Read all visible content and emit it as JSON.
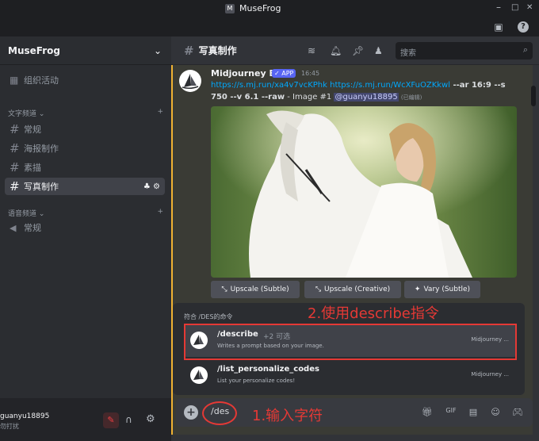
{
  "window": {
    "app_logo": "M",
    "title": "MuseFrog",
    "min": "–",
    "max": "□",
    "close": "✕"
  },
  "server": {
    "name": "MuseFrog",
    "events": "组织活动"
  },
  "categories": {
    "text": "文字频道",
    "voice": "语音频道"
  },
  "channels": {
    "c1": "常规",
    "c2": "海报制作",
    "c3": "素描",
    "c4": "写真制作",
    "v1": "常规"
  },
  "user": {
    "name": "guanyu18895",
    "status": "勿打扰"
  },
  "header": {
    "channel": "写真制作",
    "search_placeholder": "搜索"
  },
  "message": {
    "author": "Midjourney Bot",
    "badge": "✓ APP",
    "time": "16:45",
    "link1": "https://s.mj.run/xa4v7vcKPhk",
    "link2": "https://s.mj.run/WcXFuOZKkwl",
    "params1": " --ar 16:9 --s",
    "params2": "750 --v 6.1 --raw",
    "image_no": " - Image #1 ",
    "mention": "@guanyu18895",
    "edited": "(已编辑)"
  },
  "buttons": {
    "upscale_subtle": "Upscale (Subtle)",
    "upscale_creative": "Upscale (Creative)",
    "vary_subtle": "Vary (Subtle)"
  },
  "command_popup": {
    "header": "符合 /DES的命令",
    "items": [
      {
        "name": "/describe",
        "options": "+2 可选",
        "desc": "Writes a prompt based on your image.",
        "source": "Midjourney ..."
      },
      {
        "name": "/list_personalize_codes",
        "options": "",
        "desc": "List your personalize codes!",
        "source": "Midjourney ..."
      }
    ]
  },
  "input": {
    "value": "/des"
  },
  "annotations": {
    "step1": "1.输入字符",
    "step2": "2.使用describe指令"
  },
  "colors": {
    "annotation": "#e53935",
    "link": "#00a8fc",
    "blurple": "#5865f2"
  }
}
